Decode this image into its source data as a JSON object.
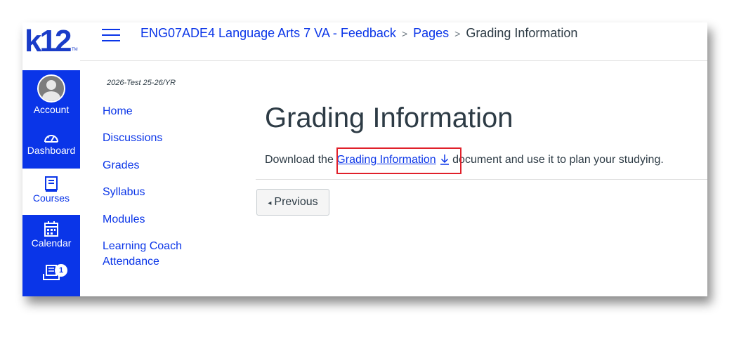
{
  "logo": {
    "text": "k12",
    "tm": "TM"
  },
  "global_nav": {
    "items": [
      {
        "label": "Account",
        "icon": "avatar-icon"
      },
      {
        "label": "Dashboard",
        "icon": "dashboard-icon"
      },
      {
        "label": "Courses",
        "icon": "book-icon"
      },
      {
        "label": "Calendar",
        "icon": "calendar-icon"
      },
      {
        "label": "",
        "icon": "inbox-icon",
        "badge": "1"
      }
    ]
  },
  "breadcrumbs": {
    "course": "ENG07ADE4 Language Arts 7 VA - Feedback",
    "section": "Pages",
    "current": "Grading Information"
  },
  "course_nav": {
    "term": "2026-Test 25-26/YR",
    "items": [
      "Home",
      "Discussions",
      "Grades",
      "Syllabus",
      "Modules",
      "Learning Coach",
      "Attendance"
    ]
  },
  "content": {
    "title": "Grading Information",
    "text_before": "Download the ",
    "link_text": "Grading Information",
    "text_after": " document and use it to plan your studying.",
    "prev_label": "Previous"
  },
  "colors": {
    "brand": "#0a35e8",
    "text": "#2d3b45",
    "highlight": "#e0202a"
  }
}
